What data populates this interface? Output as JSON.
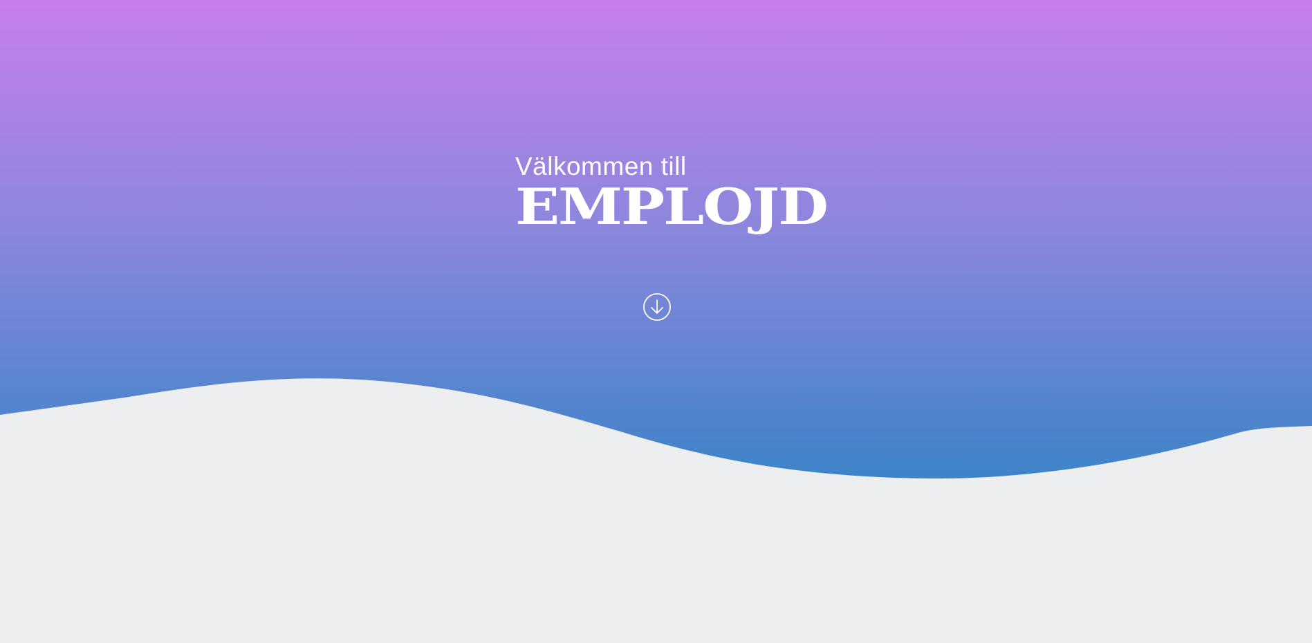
{
  "hero": {
    "welcome_text": "Välkommen till",
    "logo_text": "EMPLOJD",
    "gradient_top": "#c77eec",
    "gradient_bottom": "#3d84c8",
    "page_background": "#edeef0"
  },
  "scroll_button": {
    "icon": "arrow-down-circle-icon"
  }
}
